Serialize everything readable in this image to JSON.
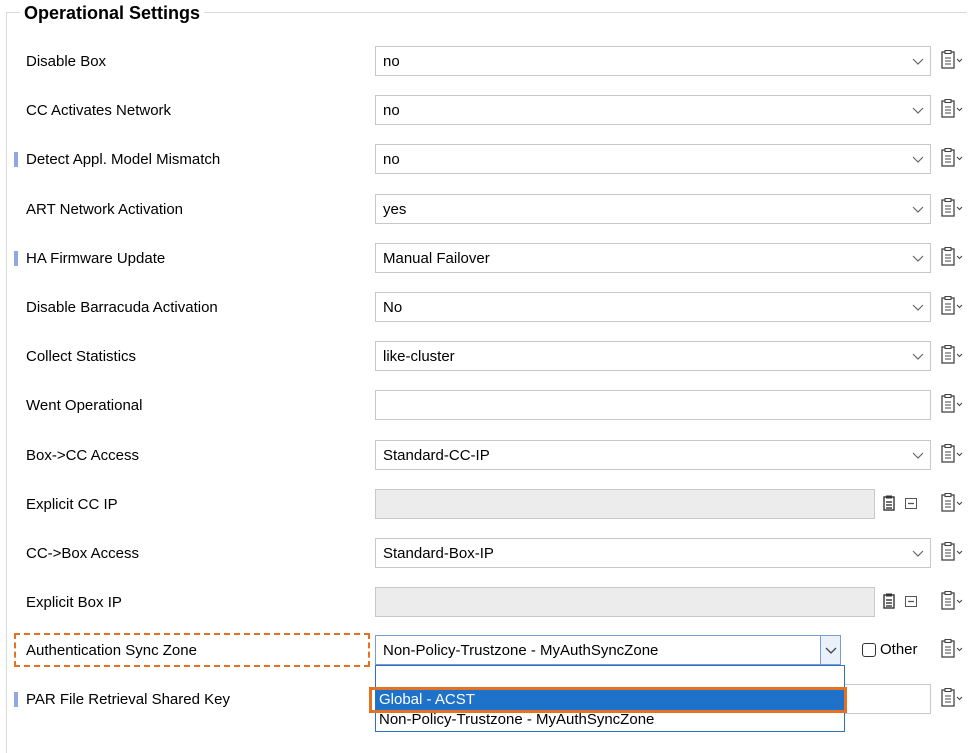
{
  "group": {
    "title": "Operational Settings"
  },
  "rows": [
    {
      "label": "Disable Box",
      "value": "no"
    },
    {
      "label": "CC Activates Network",
      "value": "no"
    },
    {
      "label": "Detect Appl. Model Mismatch",
      "value": "no"
    },
    {
      "label": "ART Network Activation",
      "value": "yes"
    },
    {
      "label": "HA Firmware Update",
      "value": "Manual Failover"
    },
    {
      "label": "Disable Barracuda Activation",
      "value": "No"
    },
    {
      "label": "Collect Statistics",
      "value": "like-cluster"
    },
    {
      "label": "Went Operational",
      "value": ""
    },
    {
      "label": "Box->CC Access",
      "value": "Standard-CC-IP"
    },
    {
      "label": "Explicit CC IP",
      "value": ""
    },
    {
      "label": "CC->Box Access",
      "value": "Standard-Box-IP"
    },
    {
      "label": "Explicit Box IP",
      "value": ""
    },
    {
      "label": "Authentication Sync Zone",
      "value": "Non-Policy-Trustzone - MyAuthSyncZone",
      "other_label": "Other"
    },
    {
      "label": "PAR File Retrieval Shared Key",
      "value": ""
    }
  ],
  "dropdown": {
    "options": [
      "",
      "Global - ACST",
      "Non-Policy-Trustzone - MyAuthSyncZone"
    ],
    "selected": "Global - ACST"
  },
  "icons": {
    "chevron": "chevron-down-icon",
    "clipboard": "clipboard-menu-icon",
    "edit": "edit-list-icon",
    "clear": "clear-icon"
  },
  "colors": {
    "highlight": "#e37322",
    "selection": "#1e72c9",
    "marker": "#8fa9e0"
  }
}
